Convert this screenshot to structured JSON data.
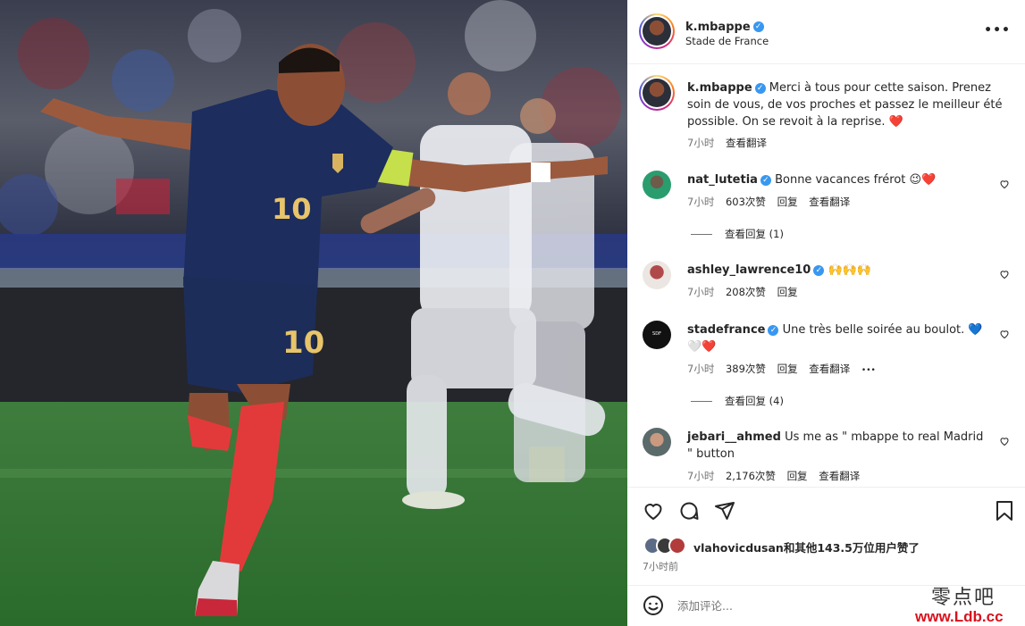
{
  "header": {
    "username": "k.mbappe",
    "location": "Stade de France",
    "more_icon": "more-horizontal-icon"
  },
  "caption": {
    "username": "k.mbappe",
    "text": "Merci à tous pour cette saison. Prenez soin de vous, de vos proches et passez le meilleur été possible. On se revoit à la reprise. ❤️",
    "time": "7小时",
    "translate": "查看翻译"
  },
  "comments": [
    {
      "username": "nat_lutetia",
      "verified": true,
      "text": "Bonne vacances frérot 😉❤️",
      "time": "7小时",
      "likes": "603次赞",
      "reply": "回复",
      "translate": "查看翻译",
      "view_replies": "查看回复 (1)"
    },
    {
      "username": "ashley_lawrence10",
      "verified": true,
      "text": "🙌🙌🙌",
      "time": "7小时",
      "likes": "208次赞",
      "reply": "回复"
    },
    {
      "username": "stadefrance",
      "verified": true,
      "text": "Une très belle soirée au boulot. 💙🤍❤️",
      "time": "7小时",
      "likes": "389次赞",
      "reply": "回复",
      "translate": "查看翻译",
      "more": "•••",
      "view_replies": "查看回复 (4)"
    },
    {
      "username": "jebari__ahmed",
      "verified": false,
      "text": "Us me as \" mbappe to real Madrid \" button",
      "time": "7小时",
      "likes": "2,176次赞",
      "reply": "回复",
      "translate": "查看翻译"
    }
  ],
  "actions": {
    "like_icon": "heart-icon",
    "comment_icon": "comment-icon",
    "share_icon": "send-icon",
    "save_icon": "bookmark-icon"
  },
  "likes": {
    "text": "vlahovicdusan和其他143.5万位用户赞了",
    "time": "7小时前"
  },
  "add_comment": {
    "emoji_icon": "smiley-icon",
    "placeholder": "添加评论..."
  },
  "watermark": {
    "title": "零点吧",
    "url": "www.Ldb.cc"
  },
  "photo": {
    "jersey_number": "10"
  },
  "colors": {
    "verified": "#3897f0",
    "heart": "#ed4956",
    "watermark_url": "#d8121e",
    "jersey": "#1c2d5e",
    "socks": "#e23a3a"
  }
}
